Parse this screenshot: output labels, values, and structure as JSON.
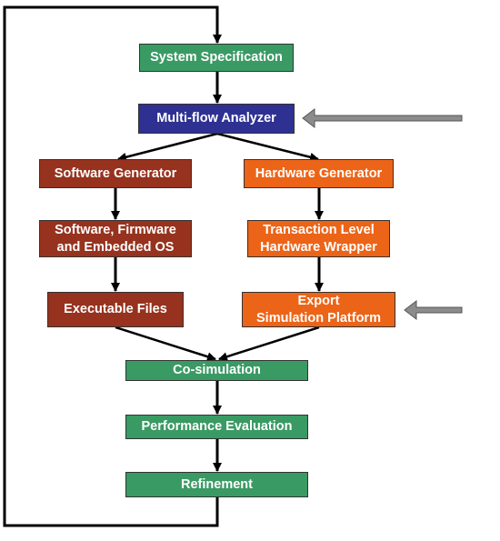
{
  "colors": {
    "green": "#3a9a64",
    "blue": "#2e3192",
    "brown": "#96321e",
    "orange": "#ec6418",
    "arrow": "#000000",
    "input_arrow": "#8c8c8c"
  },
  "nodes": {
    "system_specification": "System Specification",
    "multi_flow_analyzer": "Multi-flow Analyzer",
    "software_generator": "Software Generator",
    "hardware_generator": "Hardware Generator",
    "software_firmware_os": "Software, Firmware\nand Embedded OS",
    "transaction_level_wrapper": "Transaction Level\nHardware Wrapper",
    "executable_files": "Executable Files",
    "export_simulation_platform": "Export\nSimulation Platform",
    "co_simulation": "Co-simulation",
    "performance_evaluation": "Performance Evaluation",
    "refinement": "Refinement"
  },
  "edges": [
    [
      "system_specification",
      "multi_flow_analyzer"
    ],
    [
      "multi_flow_analyzer",
      "software_generator"
    ],
    [
      "multi_flow_analyzer",
      "hardware_generator"
    ],
    [
      "software_generator",
      "software_firmware_os"
    ],
    [
      "hardware_generator",
      "transaction_level_wrapper"
    ],
    [
      "software_firmware_os",
      "executable_files"
    ],
    [
      "transaction_level_wrapper",
      "export_simulation_platform"
    ],
    [
      "executable_files",
      "co_simulation"
    ],
    [
      "export_simulation_platform",
      "co_simulation"
    ],
    [
      "co_simulation",
      "performance_evaluation"
    ],
    [
      "performance_evaluation",
      "refinement"
    ],
    [
      "refinement",
      "system_specification"
    ]
  ],
  "external_inputs": [
    "multi_flow_analyzer",
    "export_simulation_platform"
  ]
}
